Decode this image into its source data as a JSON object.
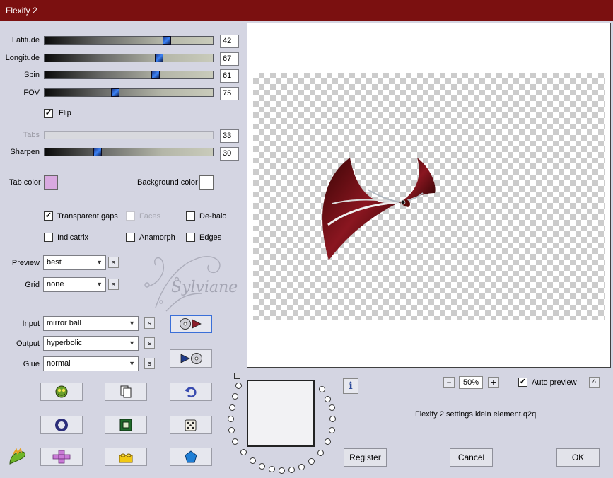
{
  "window": {
    "title": "Flexify 2"
  },
  "sliders": [
    {
      "key": "latitude",
      "label": "Latitude",
      "value": "42",
      "fraction": 0.73,
      "enabled": true
    },
    {
      "key": "longitude",
      "label": "Longitude",
      "value": "67",
      "fraction": 0.68,
      "enabled": true
    },
    {
      "key": "spin",
      "label": "Spin",
      "value": "61",
      "fraction": 0.66,
      "enabled": true
    },
    {
      "key": "fov",
      "label": "FOV",
      "value": "75",
      "fraction": 0.42,
      "enabled": true
    },
    {
      "key": "tabs",
      "label": "Tabs",
      "value": "33",
      "fraction": 0.0,
      "enabled": false
    },
    {
      "key": "sharpen",
      "label": "Sharpen",
      "value": "30",
      "fraction": 0.31,
      "enabled": true
    }
  ],
  "flip": {
    "label": "Flip",
    "checked": true
  },
  "colors": {
    "tab_color_label": "Tab color",
    "tab_color": "#d9a9e0",
    "background_color_label": "Background color",
    "background_color": "#ffffff",
    "title_bar": "#7b1010",
    "dialog_bg": "#d4d5e2"
  },
  "options": {
    "transparent_gaps": {
      "label": "Transparent gaps",
      "checked": true
    },
    "faces": {
      "label": "Faces",
      "checked": false,
      "enabled": false
    },
    "de_halo": {
      "label": "De-halo",
      "checked": false
    },
    "indicatrix": {
      "label": "Indicatrix",
      "checked": false
    },
    "anamorph": {
      "label": "Anamorph",
      "checked": false
    },
    "edges": {
      "label": "Edges",
      "checked": false
    }
  },
  "preview_select": {
    "label": "Preview",
    "value": "best"
  },
  "grid_select": {
    "label": "Grid",
    "value": "none"
  },
  "input_select": {
    "label": "Input",
    "value": "mirror ball"
  },
  "output_select": {
    "label": "Output",
    "value": "hyperbolic"
  },
  "glue_select": {
    "label": "Glue",
    "value": "normal"
  },
  "s_button_label": "s",
  "zoom": {
    "minus": "−",
    "value": "50%",
    "plus": "+"
  },
  "auto_preview": {
    "label": "Auto preview",
    "checked": true
  },
  "collapse_label": "^",
  "info_label": "i",
  "settings_file": "Flexify 2 settings klein element.q2q",
  "buttons": {
    "register": "Register",
    "cancel": "Cancel",
    "ok": "OK"
  },
  "watermark_text": "Sylviane",
  "icons": [
    "globe-frog-icon",
    "copy-icon",
    "undo-icon",
    "ring-icon",
    "chip-icon",
    "dice-icon",
    "plus-shape-icon",
    "lego-icon",
    "pentagon-icon",
    "filter-forge-logo-icon",
    "cd-arrow-icon",
    "arrow-cd-icon"
  ]
}
